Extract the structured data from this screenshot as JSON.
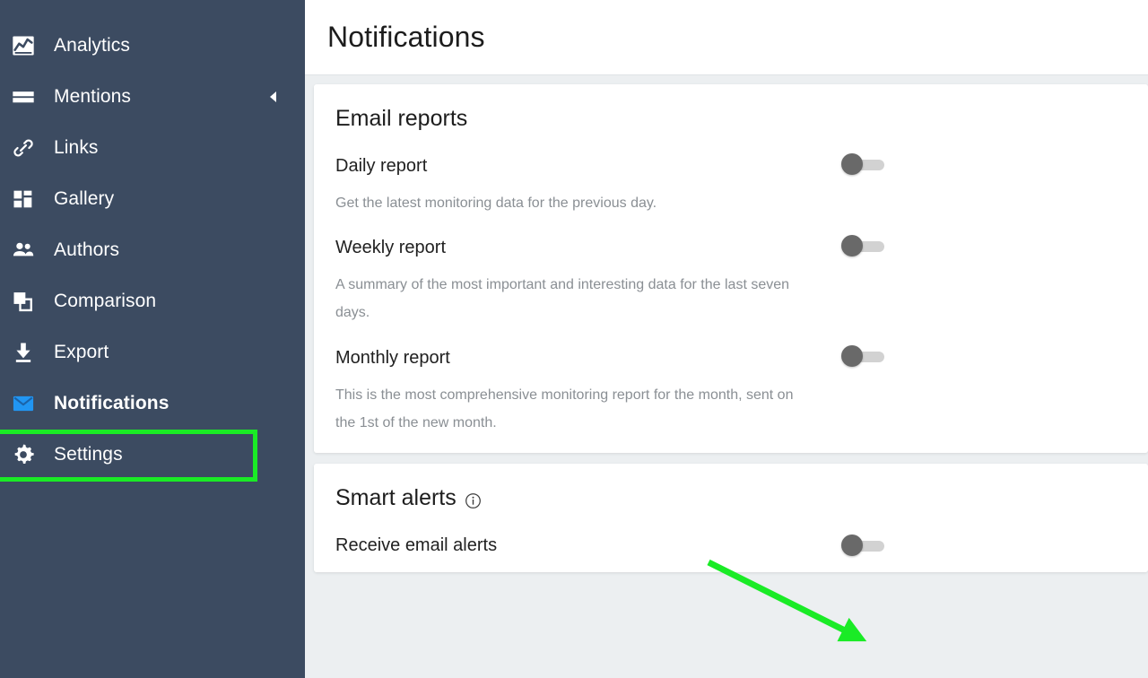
{
  "sidebar": {
    "items": [
      {
        "label": "Analytics",
        "icon": "analytics-chart-icon",
        "active": false
      },
      {
        "label": "Mentions",
        "icon": "mentions-list-icon",
        "active": false
      },
      {
        "label": "Links",
        "icon": "link-chain-icon",
        "active": false
      },
      {
        "label": "Gallery",
        "icon": "gallery-grid-icon",
        "active": false
      },
      {
        "label": "Authors",
        "icon": "authors-people-icon",
        "active": false
      },
      {
        "label": "Comparison",
        "icon": "comparison-squares-icon",
        "active": false
      },
      {
        "label": "Export",
        "icon": "export-download-icon",
        "active": false
      },
      {
        "label": "Notifications",
        "icon": "envelope-icon",
        "active": true
      },
      {
        "label": "Settings",
        "icon": "gear-icon",
        "active": false
      }
    ],
    "collapse_icon": "chevron-left-icon",
    "background_color": "#3c4b61",
    "active_icon_color": "#2196f3"
  },
  "header": {
    "title": "Notifications"
  },
  "annotations": {
    "highlight_color": "#1aeb26",
    "arrow_color": "#1aeb26",
    "highlight_target": "sidebar-item-notifications",
    "arrow_target": "receive-email-alerts-toggle"
  },
  "cards": [
    {
      "title": "Email reports",
      "info_icon": false,
      "rows": [
        {
          "label": "Daily report",
          "description": "Get the latest monitoring data for the previous day.",
          "toggle_state": "off"
        },
        {
          "label": "Weekly report",
          "description": "A summary of the most important and interesting data for the last seven days.",
          "toggle_state": "off"
        },
        {
          "label": "Monthly report",
          "description": "This is the most comprehensive monitoring report for the month, sent on the 1st of the new month.",
          "toggle_state": "off"
        }
      ]
    },
    {
      "title": "Smart alerts",
      "info_icon": true,
      "rows": [
        {
          "label": "Receive email alerts",
          "description": "",
          "toggle_state": "off"
        }
      ]
    }
  ]
}
